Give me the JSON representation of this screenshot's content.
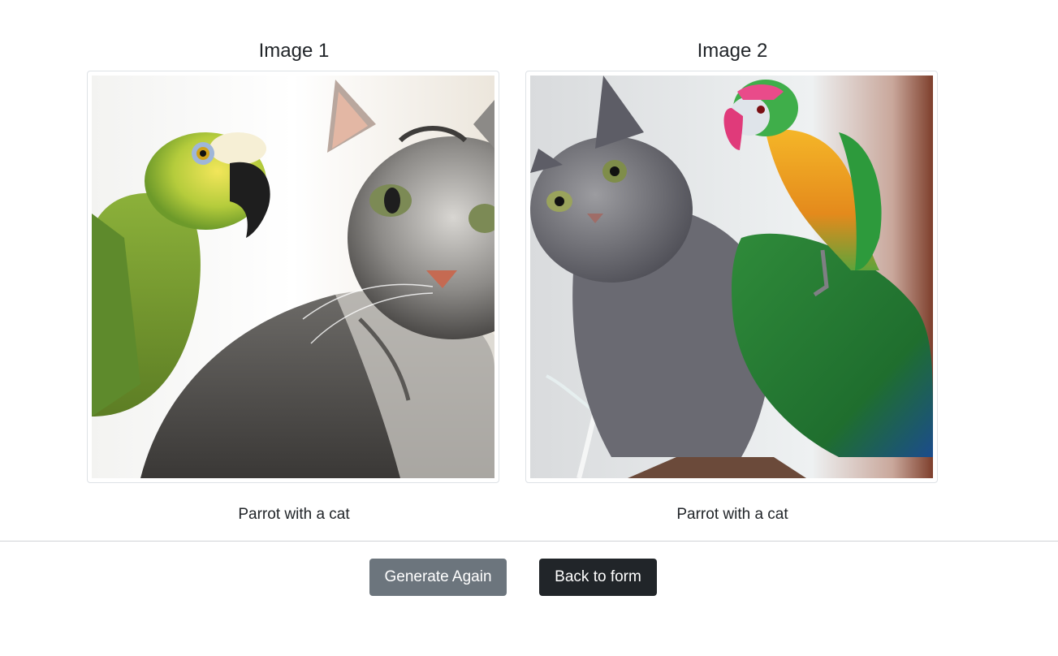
{
  "images": [
    {
      "title": "Image 1",
      "caption": "Parrot with a cat"
    },
    {
      "title": "Image 2",
      "caption": "Parrot with a cat"
    }
  ],
  "actions": {
    "generate_again_label": "Generate Again",
    "back_to_form_label": "Back to form"
  },
  "colors": {
    "secondary_button": "#6c757d",
    "dark_button": "#212529",
    "border": "#dee2e6"
  }
}
